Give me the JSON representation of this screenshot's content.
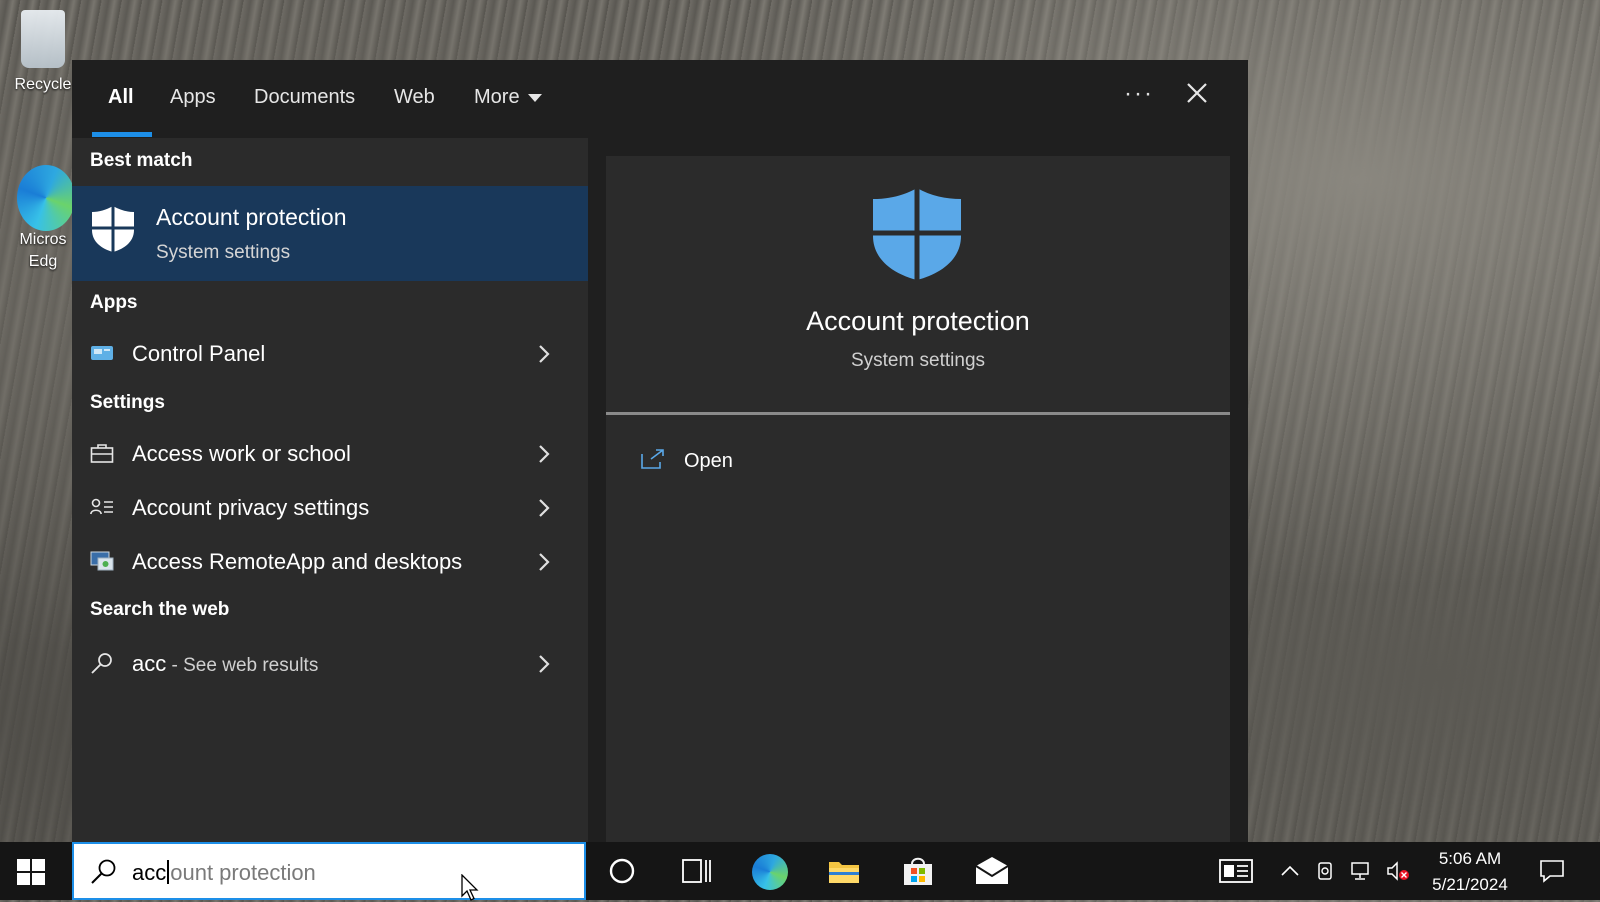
{
  "desktop": {
    "icons": [
      {
        "label": "Recycle"
      },
      {
        "label": "Micros",
        "label2": "Edg"
      }
    ]
  },
  "search_panel": {
    "tabs": [
      {
        "label": "All",
        "active": true
      },
      {
        "label": "Apps"
      },
      {
        "label": "Documents"
      },
      {
        "label": "Web"
      },
      {
        "label": "More"
      }
    ],
    "more_options_label": "···",
    "best_match": {
      "heading": "Best match",
      "title": "Account protection",
      "subtitle": "System settings"
    },
    "apps": {
      "heading": "Apps",
      "items": [
        {
          "label": "Control Panel",
          "icon": "control-panel-icon"
        }
      ]
    },
    "settings": {
      "heading": "Settings",
      "items": [
        {
          "label": "Access work or school",
          "icon": "briefcase-icon"
        },
        {
          "label": "Account privacy settings",
          "icon": "person-list-icon"
        },
        {
          "label": "Access RemoteApp and desktops",
          "icon": "remote-desktop-icon"
        }
      ]
    },
    "web": {
      "heading": "Search the web",
      "query": "acc",
      "suffix": " - See web results"
    },
    "preview": {
      "title": "Account protection",
      "subtitle": "System settings",
      "action_label": "Open"
    }
  },
  "taskbar": {
    "search": {
      "typed": "acc",
      "ghost": "ount protection"
    },
    "clock": {
      "time": "5:06 AM",
      "date": "5/21/2024"
    }
  },
  "colors": {
    "accent": "#1d8fe8",
    "selected_row": "#19385a",
    "panel_bg": "#2b2b2b",
    "shield_blue": "#5aa8e8"
  }
}
